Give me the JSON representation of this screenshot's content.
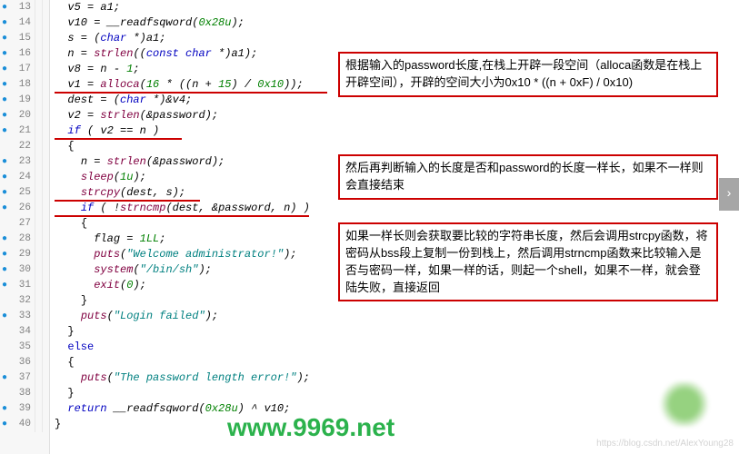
{
  "lines": [
    {
      "n": 13,
      "dot": true,
      "indent": 2,
      "tokens": [
        "v5 = a1;"
      ],
      "ident_line": true
    },
    {
      "n": 14,
      "dot": true,
      "indent": 2,
      "tokens": [
        "v10 = ",
        {
          "t": "__readfsqword",
          "c": ""
        },
        "(",
        {
          "t": "0x28u",
          "c": "num"
        },
        ");"
      ],
      "ident_line": true
    },
    {
      "n": 15,
      "dot": true,
      "indent": 2,
      "tokens": [
        "s = (",
        {
          "t": "char",
          "c": "type"
        },
        " *)a1;"
      ],
      "ident_line": true
    },
    {
      "n": 16,
      "dot": true,
      "indent": 2,
      "tokens": [
        "n = ",
        {
          "t": "strlen",
          "c": "fn"
        },
        "((",
        {
          "t": "const char",
          "c": "type"
        },
        " *)a1);"
      ],
      "ident_line": true
    },
    {
      "n": 17,
      "dot": true,
      "indent": 2,
      "tokens": [
        "v8 = n - ",
        {
          "t": "1",
          "c": "num"
        },
        ";"
      ],
      "ident_line": true
    },
    {
      "n": 18,
      "dot": true,
      "indent": 2,
      "tokens": [
        "v1 = ",
        {
          "t": "alloca",
          "c": "fn"
        },
        "(",
        {
          "t": "16",
          "c": "num"
        },
        " * ((n + ",
        {
          "t": "15",
          "c": "num"
        },
        ") / ",
        {
          "t": "0x10",
          "c": "num"
        },
        "));"
      ],
      "ident_line": true,
      "ul": true
    },
    {
      "n": 19,
      "dot": true,
      "indent": 2,
      "tokens": [
        "dest = (",
        {
          "t": "char",
          "c": "type"
        },
        " *)&v4;"
      ],
      "ident_line": true
    },
    {
      "n": 20,
      "dot": true,
      "indent": 2,
      "tokens": [
        "v2 = ",
        {
          "t": "strlen",
          "c": "fn"
        },
        "(&password);"
      ],
      "ident_line": true
    },
    {
      "n": 21,
      "dot": true,
      "indent": 2,
      "tokens": [
        {
          "t": "if",
          "c": "kw"
        },
        " ( v2 == n )"
      ],
      "ident_line": true,
      "ul": true
    },
    {
      "n": 22,
      "dot": false,
      "indent": 2,
      "tokens": [
        "{"
      ]
    },
    {
      "n": 23,
      "dot": true,
      "indent": 4,
      "tokens": [
        "n = ",
        {
          "t": "strlen",
          "c": "fn"
        },
        "(&password);"
      ],
      "ident_line": true
    },
    {
      "n": 24,
      "dot": true,
      "indent": 4,
      "tokens": [
        {
          "t": "sleep",
          "c": "fn"
        },
        "(",
        {
          "t": "1u",
          "c": "num"
        },
        ");"
      ],
      "ident_line": true
    },
    {
      "n": 25,
      "dot": true,
      "indent": 4,
      "tokens": [
        {
          "t": "strcpy",
          "c": "fn"
        },
        "(dest, s);"
      ],
      "ident_line": true,
      "ul": true
    },
    {
      "n": 26,
      "dot": true,
      "indent": 4,
      "tokens": [
        {
          "t": "if",
          "c": "kw"
        },
        " ( !",
        {
          "t": "strncmp",
          "c": "fn"
        },
        "(dest, &password, n) )"
      ],
      "ident_line": true,
      "ul": true
    },
    {
      "n": 27,
      "dot": false,
      "indent": 4,
      "tokens": [
        "{"
      ]
    },
    {
      "n": 28,
      "dot": true,
      "indent": 6,
      "tokens": [
        "flag = ",
        {
          "t": "1LL",
          "c": "num"
        },
        ";"
      ],
      "ident_line": true
    },
    {
      "n": 29,
      "dot": true,
      "indent": 6,
      "tokens": [
        {
          "t": "puts",
          "c": "fn"
        },
        "(",
        {
          "t": "\"Welcome administrator!\"",
          "c": "str"
        },
        ");"
      ],
      "ident_line": true
    },
    {
      "n": 30,
      "dot": true,
      "indent": 6,
      "tokens": [
        {
          "t": "system",
          "c": "fn"
        },
        "(",
        {
          "t": "\"/bin/sh\"",
          "c": "str"
        },
        ");"
      ],
      "ident_line": true
    },
    {
      "n": 31,
      "dot": true,
      "indent": 6,
      "tokens": [
        {
          "t": "exit",
          "c": "fn"
        },
        "(",
        {
          "t": "0",
          "c": "num"
        },
        ");"
      ],
      "ident_line": true
    },
    {
      "n": 32,
      "dot": false,
      "indent": 4,
      "tokens": [
        "}"
      ]
    },
    {
      "n": 33,
      "dot": true,
      "indent": 4,
      "tokens": [
        {
          "t": "puts",
          "c": "fn"
        },
        "(",
        {
          "t": "\"Login failed\"",
          "c": "str"
        },
        ");"
      ],
      "ident_line": true
    },
    {
      "n": 34,
      "dot": false,
      "indent": 2,
      "tokens": [
        "}"
      ]
    },
    {
      "n": 35,
      "dot": false,
      "indent": 2,
      "tokens": [
        {
          "t": "else",
          "c": "kw"
        }
      ]
    },
    {
      "n": 36,
      "dot": false,
      "indent": 2,
      "tokens": [
        "{"
      ]
    },
    {
      "n": 37,
      "dot": true,
      "indent": 4,
      "tokens": [
        {
          "t": "puts",
          "c": "fn"
        },
        "(",
        {
          "t": "\"The password length error!\"",
          "c": "str"
        },
        ");"
      ],
      "ident_line": true
    },
    {
      "n": 38,
      "dot": false,
      "indent": 2,
      "tokens": [
        "}"
      ]
    },
    {
      "n": 39,
      "dot": true,
      "indent": 2,
      "tokens": [
        {
          "t": "return",
          "c": "kw"
        },
        " ",
        {
          "t": "__readfsqword",
          "c": ""
        },
        "(",
        {
          "t": "0x28u",
          "c": "num"
        },
        ") ^ v10;"
      ],
      "ident_line": true
    },
    {
      "n": 40,
      "dot": true,
      "indent": 0,
      "tokens": [
        "}"
      ]
    }
  ],
  "annotations": [
    {
      "id": "a1",
      "text": "根据输入的password长度,在栈上开辟一段空间（alloca函数是在栈上开辟空间），开辟的空间大小为0x10 * ((n + 0xF) / 0x10)"
    },
    {
      "id": "a2",
      "text": "然后再判断输入的长度是否和password的长度一样长，如果不一样则会直接结束"
    },
    {
      "id": "a3",
      "text": "如果一样长则会获取要比较的字符串长度，然后会调用strcpy函数，将密码从bss段上复制一份到栈上，然后调用strncmp函数来比较输入是否与密码一样，如果一样的话，则起一个shell，如果不一样，就会登陆失败，直接返回"
    }
  ],
  "watermark": "www.9969.net",
  "csdn": "https://blog.csdn.net/AlexYoung28",
  "sidebtn": "›"
}
